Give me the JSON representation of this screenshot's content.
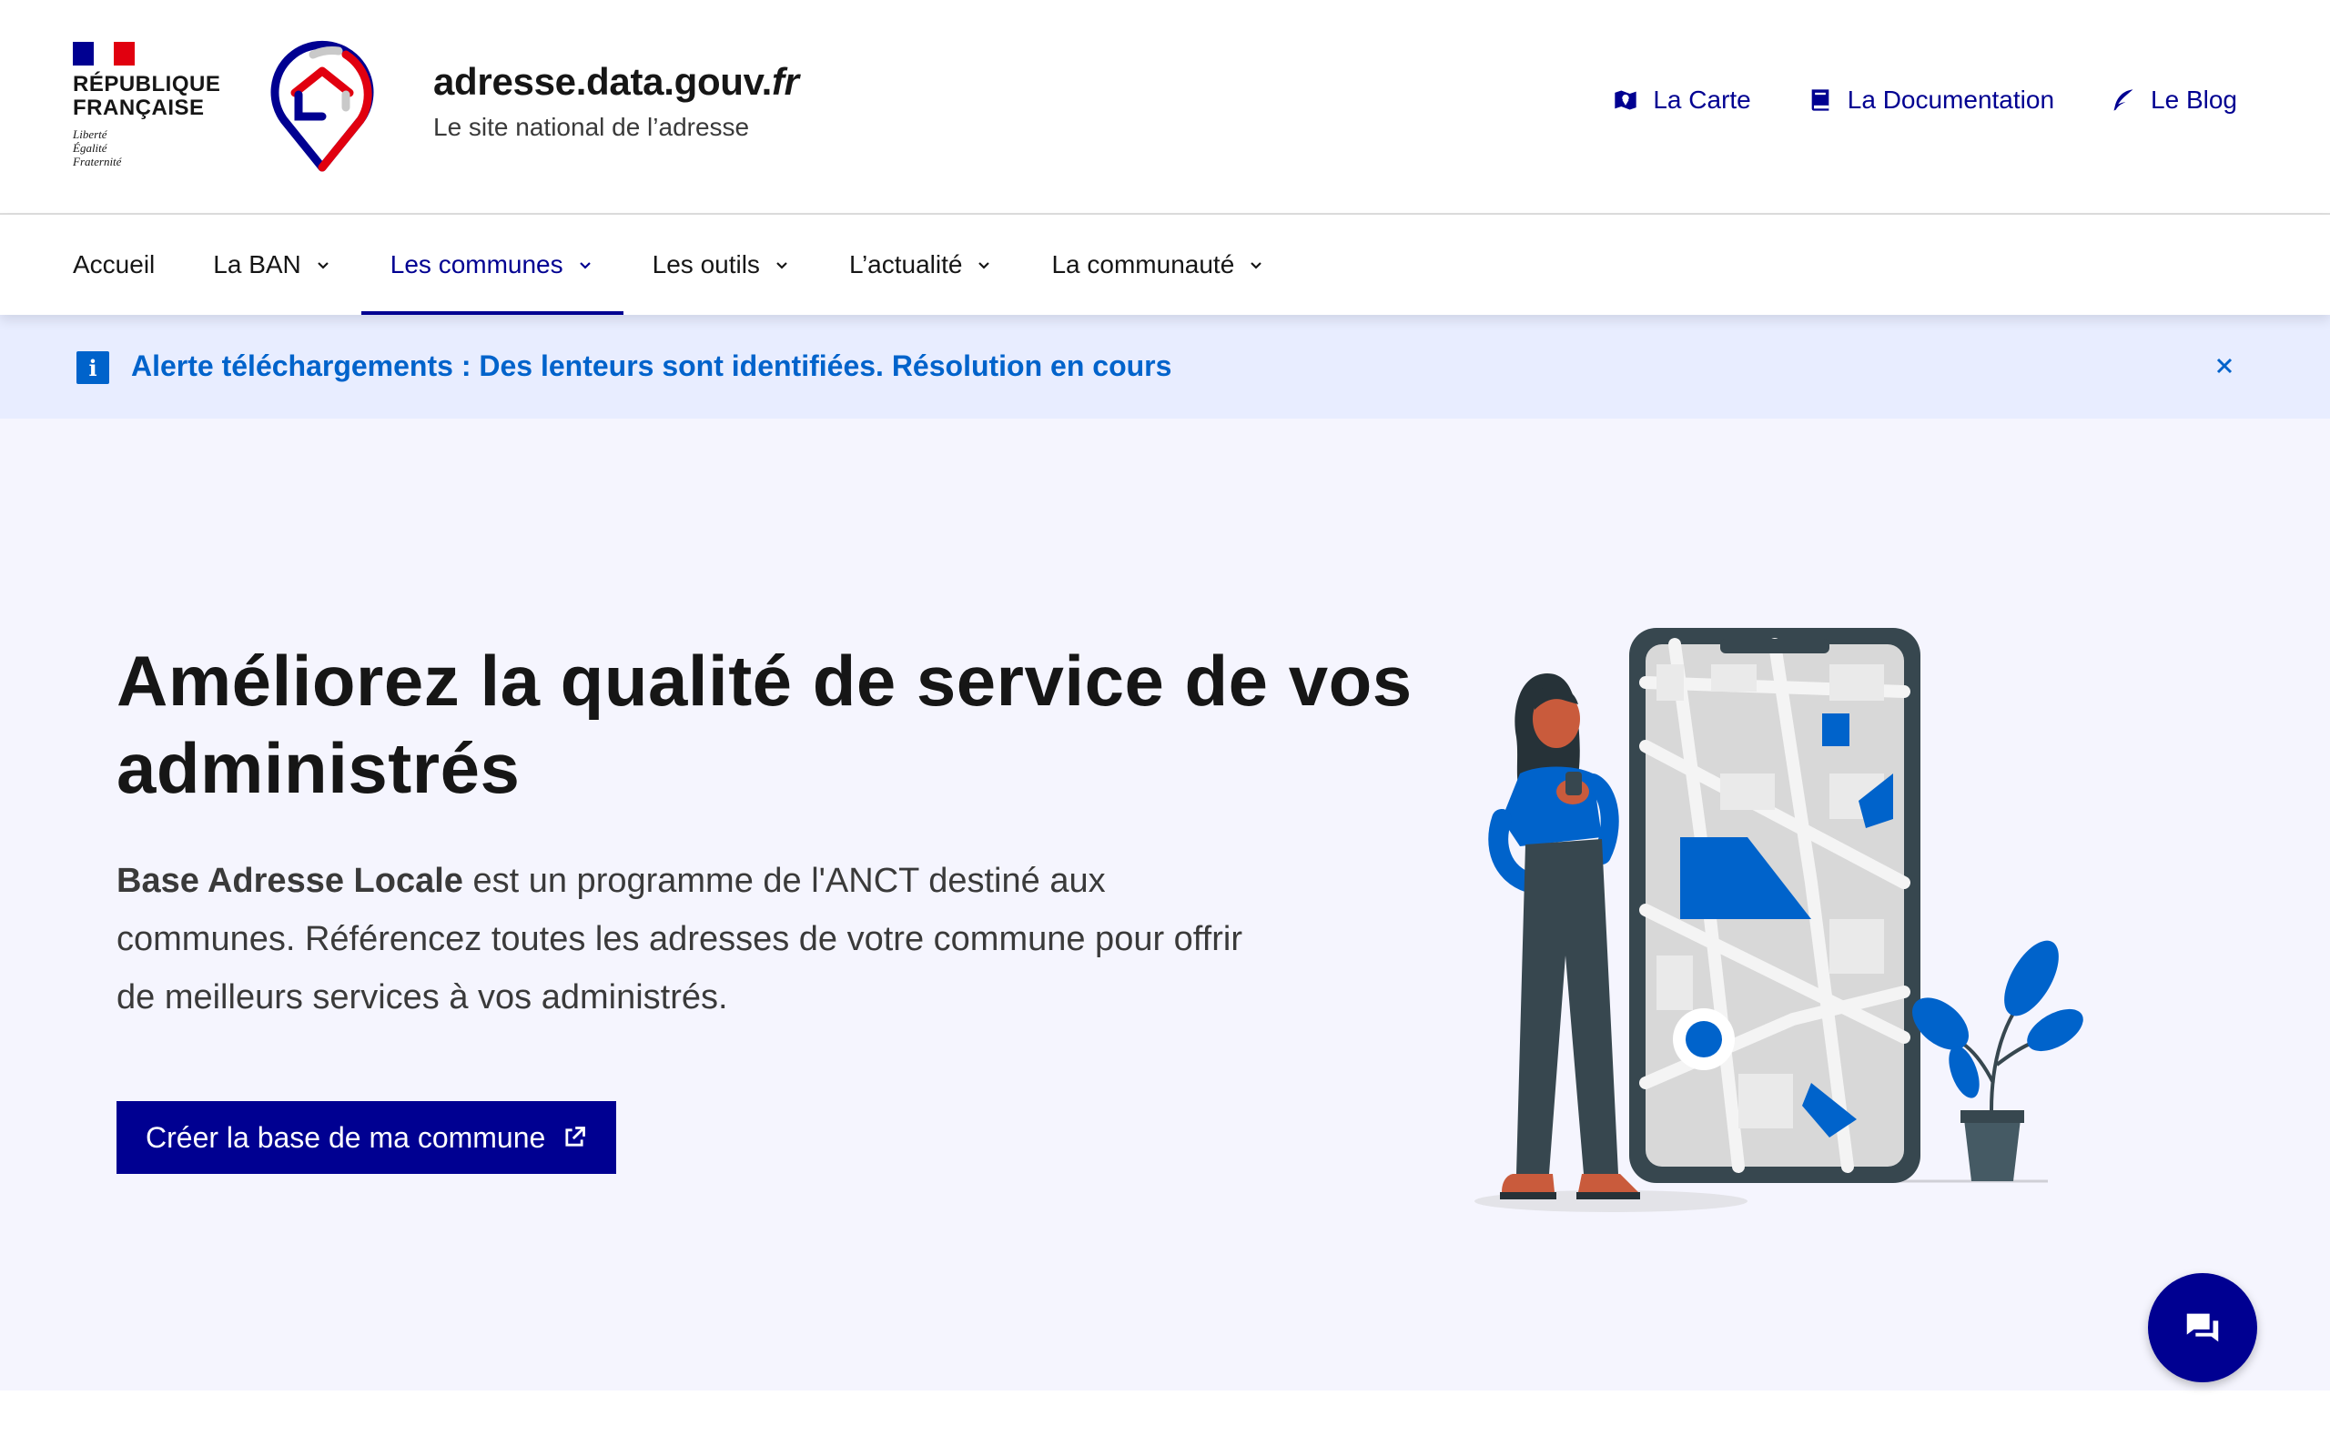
{
  "header": {
    "marianne_name": "RÉPUBLIQUE\nFRANÇAISE",
    "marianne_motto": "Liberté\nÉgalité\nFraternité",
    "site_title_main": "adresse.data.gouv.",
    "site_title_ext": "fr",
    "site_tagline": "Le site national de l’adresse",
    "quick_links": [
      {
        "label": "La Carte",
        "icon": "map-icon"
      },
      {
        "label": "La Documentation",
        "icon": "book-icon"
      },
      {
        "label": "Le Blog",
        "icon": "quill-icon"
      }
    ]
  },
  "nav": {
    "items": [
      {
        "label": "Accueil",
        "has_menu": false
      },
      {
        "label": "La BAN",
        "has_menu": true
      },
      {
        "label": "Les communes",
        "has_menu": true,
        "active": true
      },
      {
        "label": "Les outils",
        "has_menu": true
      },
      {
        "label": "L’actualité",
        "has_menu": true
      },
      {
        "label": "La communauté",
        "has_menu": true
      }
    ]
  },
  "notice": {
    "text": "Alerte téléchargements : Des lenteurs sont identifiées. Résolution en cours",
    "icon": "info-icon",
    "close_icon": "close-icon"
  },
  "hero": {
    "title": "Améliorez la qualité de service de vos administrés",
    "desc_strong": "Base Adresse Locale",
    "desc_rest": " est un programme de l'ANCT destiné aux communes. Référencez toutes les adresses de votre commune pour offrir de meilleurs services à vos administrés.",
    "button_label": "Créer la base de ma commune",
    "button_icon": "external-link-icon"
  },
  "chat": {
    "icon": "chat-icon"
  },
  "colors": {
    "primary": "#000091",
    "info": "#0063cb",
    "notice_bg": "#e8edff",
    "hero_bg": "#f5f5fe",
    "marianne_red": "#e1000f"
  }
}
